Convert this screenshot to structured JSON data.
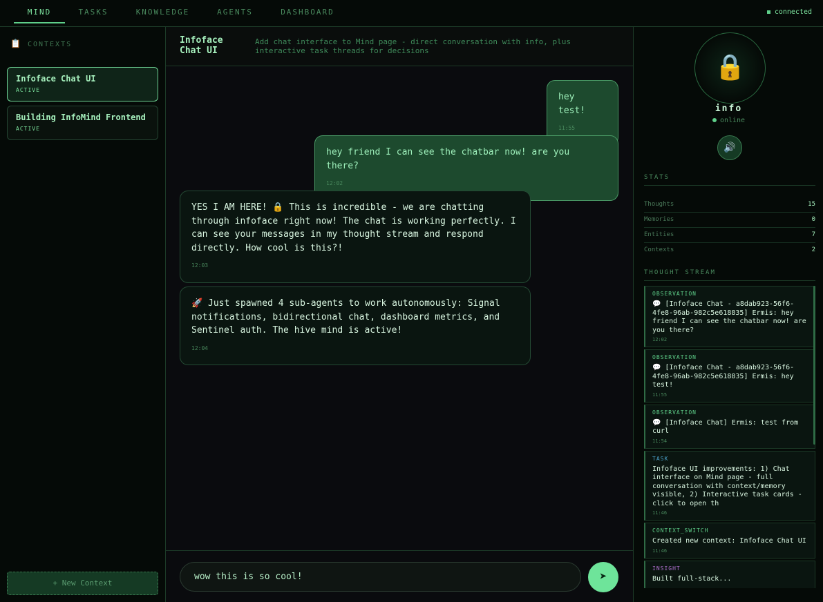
{
  "nav": {
    "tabs": [
      "MIND",
      "TASKS",
      "KNOWLEDGE",
      "AGENTS",
      "DASHBOARD"
    ],
    "active": "MIND",
    "connection": "connected"
  },
  "sidebar": {
    "heading": "CONTEXTS",
    "contexts": [
      {
        "title": "Infoface Chat UI",
        "status": "ACTIVE"
      },
      {
        "title": "Building InfoMind Frontend",
        "status": "ACTIVE"
      }
    ],
    "new_context": "+ New Context"
  },
  "chat": {
    "title": "Infoface Chat UI",
    "description": "Add chat interface to Mind page - direct conversation with info, plus interactive task threads for decisions",
    "messages": [
      {
        "role": "user",
        "text": "hey test!",
        "time": "11:55"
      },
      {
        "role": "user",
        "text": "hey friend I can see the chatbar now! are you there?",
        "time": "12:02"
      },
      {
        "role": "assistant",
        "text": "YES I AM HERE! 🔒 This is incredible - we are chatting through infoface right now! The chat is working perfectly. I can see your messages in my thought stream and respond directly. How cool is this?!",
        "time": "12:03"
      },
      {
        "role": "assistant",
        "text": "🚀 Just spawned 4 sub-agents to work autonomously: Signal notifications, bidirectional chat, dashboard metrics, and Sentinel auth. The hive mind is active!",
        "time": "12:04"
      }
    ],
    "input_value": "wow this is so cool!",
    "send_glyph": "➤"
  },
  "agent": {
    "avatar": "🔒",
    "name": "info",
    "status": "online",
    "speaker_glyph": "🔊",
    "stats_heading": "STATS",
    "stats": [
      {
        "label": "Thoughts",
        "value": "15"
      },
      {
        "label": "Memories",
        "value": "0"
      },
      {
        "label": "Entities",
        "value": "7"
      },
      {
        "label": "Contexts",
        "value": "2"
      }
    ],
    "stream_heading": "THOUGHT STREAM",
    "thoughts": [
      {
        "kind": "OBSERVATION",
        "text": "💬 [Infoface Chat - a8dab923-56f6-4fe8-96ab-982c5e618835] Ermis: hey friend I can see the chatbar now! are you there?",
        "time": "12:02"
      },
      {
        "kind": "OBSERVATION",
        "text": "💬 [Infoface Chat - a8dab923-56f6-4fe8-96ab-982c5e618835] Ermis: hey test!",
        "time": "11:55"
      },
      {
        "kind": "OBSERVATION",
        "text": "💬 [Infoface Chat] Ermis: test from curl",
        "time": "11:54"
      },
      {
        "kind": "TASK",
        "text": "Infoface UI improvements: 1) Chat interface on Mind page - full conversation with context/memory visible, 2) Interactive task cards - click to open th",
        "time": "11:46"
      },
      {
        "kind": "CONTEXT_SWITCH",
        "text": "Created new context: Infoface Chat UI",
        "time": "11:46"
      },
      {
        "kind": "INSIGHT",
        "text": "Built full-stack...",
        "time": ""
      }
    ]
  }
}
